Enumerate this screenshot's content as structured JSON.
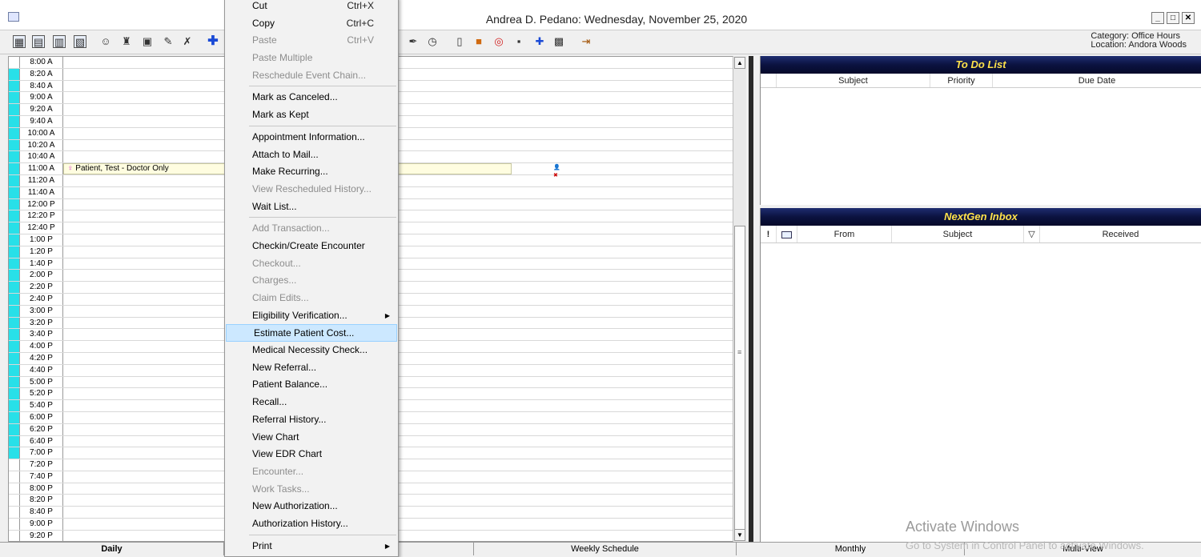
{
  "window": {
    "title": "Andrea D. Pedano: Wednesday, November 25, 2020"
  },
  "header_info": {
    "category": "Category: Office Hours",
    "location": "Location: Andora Woods"
  },
  "schedule": {
    "slots": [
      "8:00 A",
      "8:20 A",
      "8:40 A",
      "9:00 A",
      "9:20 A",
      "9:40 A",
      "10:00 A",
      "10:20 A",
      "10:40 A",
      "11:00 A",
      "11:20 A",
      "11:40 A",
      "12:00 P",
      "12:20 P",
      "12:40 P",
      "1:00 P",
      "1:20 P",
      "1:40 P",
      "2:00 P",
      "2:20 P",
      "2:40 P",
      "3:00 P",
      "3:20 P",
      "3:40 P",
      "4:00 P",
      "4:20 P",
      "4:40 P",
      "5:00 P",
      "5:20 P",
      "5:40 P",
      "6:00 P",
      "6:20 P",
      "6:40 P",
      "7:00 P",
      "7:20 P",
      "7:40 P",
      "8:00 P",
      "8:20 P",
      "8:40 P",
      "9:00 P",
      "9:20 P"
    ],
    "appointment": {
      "time": "11:00 A",
      "text": "Patient, Test -  Doctor Only"
    }
  },
  "todo": {
    "title": "To Do List",
    "columns": [
      "Subject",
      "Priority",
      "Due Date"
    ]
  },
  "inbox": {
    "title": "NextGen Inbox",
    "columns": [
      "!",
      "",
      "From",
      "Subject",
      "▽",
      "Received"
    ]
  },
  "tabs": [
    "Daily",
    "",
    "Weekly Schedule",
    "Monthly",
    "Multi-View"
  ],
  "context_menu": {
    "items": [
      {
        "label": "Cut",
        "shortcut": "Ctrl+X",
        "disabled": false
      },
      {
        "label": "Copy",
        "shortcut": "Ctrl+C",
        "disabled": false
      },
      {
        "label": "Paste",
        "shortcut": "Ctrl+V",
        "disabled": true
      },
      {
        "label": "Paste Multiple",
        "shortcut": "",
        "disabled": true
      },
      {
        "label": "Reschedule Event Chain...",
        "shortcut": "",
        "disabled": true
      },
      {
        "sep": true
      },
      {
        "label": "Mark as Canceled...",
        "disabled": false
      },
      {
        "label": "Mark as Kept",
        "disabled": false
      },
      {
        "sep": true
      },
      {
        "label": "Appointment Information...",
        "disabled": false
      },
      {
        "label": "Attach to Mail...",
        "disabled": false
      },
      {
        "label": "Make Recurring...",
        "disabled": false
      },
      {
        "label": "View Rescheduled History...",
        "disabled": true
      },
      {
        "label": "Wait List...",
        "disabled": false
      },
      {
        "sep": true
      },
      {
        "label": "Add Transaction...",
        "disabled": true
      },
      {
        "label": "Checkin/Create Encounter",
        "disabled": false
      },
      {
        "label": "Checkout...",
        "disabled": true
      },
      {
        "label": "Charges...",
        "disabled": true
      },
      {
        "label": "Claim Edits...",
        "disabled": true
      },
      {
        "label": "Eligibility Verification...",
        "disabled": false,
        "submenu": true
      },
      {
        "label": "Estimate Patient Cost...",
        "disabled": false,
        "highlighted": true
      },
      {
        "label": "Medical Necessity Check...",
        "disabled": false
      },
      {
        "label": "New Referral...",
        "disabled": false
      },
      {
        "label": "Patient Balance...",
        "disabled": false
      },
      {
        "label": "Recall...",
        "disabled": false
      },
      {
        "label": "Referral History...",
        "disabled": false
      },
      {
        "label": "View Chart",
        "disabled": false
      },
      {
        "label": "View EDR Chart",
        "disabled": false
      },
      {
        "label": "Encounter...",
        "disabled": true
      },
      {
        "label": "Work Tasks...",
        "disabled": true
      },
      {
        "label": "New Authorization...",
        "disabled": false
      },
      {
        "label": "Authorization History...",
        "disabled": false
      },
      {
        "sep": true
      },
      {
        "label": "Print",
        "disabled": false,
        "submenu": true
      }
    ]
  },
  "watermark": {
    "line1": "Activate Windows",
    "line2": "Go to System in Control Panel to activate Windows."
  }
}
